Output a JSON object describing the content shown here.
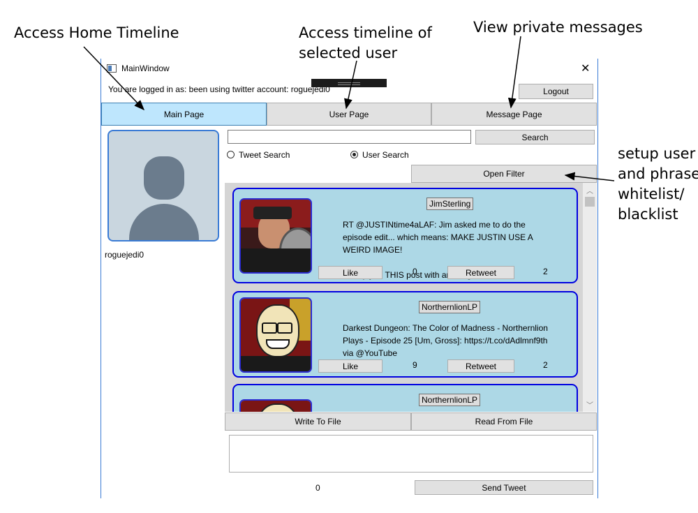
{
  "annotations": {
    "home": "Access Home Timeline",
    "user_line1": "Access timeline of",
    "user_line2": "selected user",
    "messages": "View private messages",
    "filter_line1": "setup user",
    "filter_line2": "and phrase",
    "filter_line3": "whitelist/",
    "filter_line4": "blacklist"
  },
  "window": {
    "title": "MainWindow",
    "close_glyph": "✕",
    "logged_in_text": "You are logged in as: been using twitter account: roguejedi0",
    "logout_label": "Logout"
  },
  "tabs": [
    {
      "label": "Main Page",
      "active": true
    },
    {
      "label": "User Page",
      "active": false
    },
    {
      "label": "Message Page",
      "active": false
    }
  ],
  "profile": {
    "username": "roguejedi0"
  },
  "search": {
    "value": "",
    "button_label": "Search",
    "option_tweet": "Tweet Search",
    "option_user": "User Search",
    "selected": "User Search"
  },
  "filter_label": "Open Filter",
  "tweets": [
    {
      "user": "JimSterling",
      "text": "RT @JUSTINtime4aLAF: Jim asked me to do the episode edit... which means: MAKE JUSTIN USE A WEIRD IMAGE!\n\n1. Reply to THIS post with an imag...",
      "like_label": "Like",
      "likes": "0",
      "retweet_label": "Retweet",
      "retweets": "2"
    },
    {
      "user": "NorthernlionLP",
      "text": "Darkest Dungeon: The Color of Madness - Northernlion Plays - Episode 25 [Um, Gross]: https://t.co/dAdlmnf9th via @YouTube",
      "like_label": "Like",
      "likes": "9",
      "retweet_label": "Retweet",
      "retweets": "2"
    },
    {
      "user": "NorthernlionLP"
    }
  ],
  "file": {
    "write_label": "Write To File",
    "read_label": "Read From File"
  },
  "compose": {
    "value": "",
    "char_count": "0",
    "send_label": "Send Tweet"
  },
  "colors": {
    "accent": "#0000e0",
    "card_bg": "#add8e6",
    "tab_active": "#bee6fd"
  }
}
